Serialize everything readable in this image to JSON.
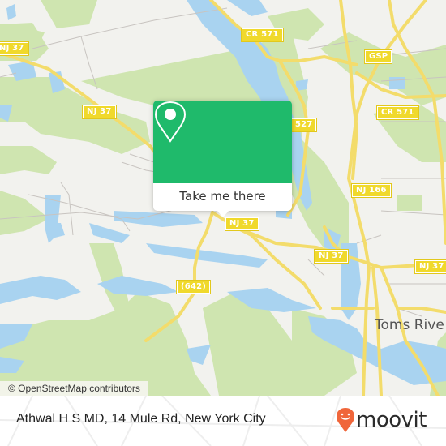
{
  "map": {
    "colors": {
      "land": "#f2f2ee",
      "park": "#cfe5b0",
      "water": "#a9d3f0",
      "road_major": "#f3dc6b",
      "road_minor": "#c8c4c0",
      "shield_fill": "#f0d92c"
    },
    "route_shields": [
      {
        "id": "nj37-top-left",
        "label": "NJ 37"
      },
      {
        "id": "nj37-left",
        "label": "NJ 37"
      },
      {
        "id": "cr571-top",
        "label": "CR 571"
      },
      {
        "id": "gsp",
        "label": "GSP"
      },
      {
        "id": "cr571-right",
        "label": "CR 571"
      },
      {
        "id": "cr527",
        "label": "527"
      },
      {
        "id": "nj166",
        "label": "NJ 166"
      },
      {
        "id": "nj37-center",
        "label": "NJ 37"
      },
      {
        "id": "nj37-east",
        "label": "NJ 37"
      },
      {
        "id": "nj37-far-east",
        "label": "NJ 37"
      },
      {
        "id": "cr642",
        "label": "(642)"
      }
    ],
    "place_labels": [
      {
        "id": "toms-river",
        "label": "Toms Rive"
      }
    ],
    "attribution": "© OpenStreetMap contributors"
  },
  "popup": {
    "icon": "map-pin-icon",
    "button_label": "Take me there",
    "accent_color": "#1fba6b"
  },
  "footer": {
    "title": "Athwal H S MD, 14 Mule Rd, New York City",
    "logo": {
      "icon": "moovit-smiley-pin-icon",
      "text": "moovit",
      "color": "#f0663a"
    }
  }
}
